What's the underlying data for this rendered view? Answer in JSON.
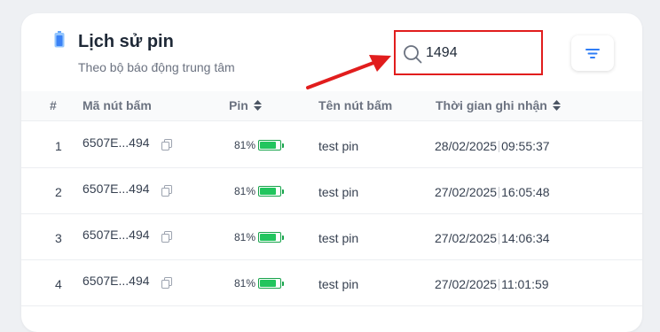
{
  "header": {
    "title": "Lịch sử pin",
    "subtitle": "Theo bộ báo động trung tâm"
  },
  "search": {
    "value": "1494"
  },
  "table": {
    "columns": {
      "index": "#",
      "button_code": "Mã nút bấm",
      "battery": "Pin",
      "button_name": "Tên nút bấm",
      "recorded_time": "Thời gian ghi nhận"
    },
    "rows": [
      {
        "index": "1",
        "code": "6507E...494",
        "battery": "81%",
        "battery_level": 0.81,
        "name": "test pin",
        "date": "28/02/2025",
        "time": "09:55:37"
      },
      {
        "index": "2",
        "code": "6507E...494",
        "battery": "81%",
        "battery_level": 0.81,
        "name": "test pin",
        "date": "27/02/2025",
        "time": "16:05:48"
      },
      {
        "index": "3",
        "code": "6507E...494",
        "battery": "81%",
        "battery_level": 0.81,
        "name": "test pin",
        "date": "27/02/2025",
        "time": "14:06:34"
      },
      {
        "index": "4",
        "code": "6507E...494",
        "battery": "81%",
        "battery_level": 0.81,
        "name": "test pin",
        "date": "27/02/2025",
        "time": "11:01:59"
      }
    ]
  },
  "colors": {
    "accent": "#2f7df6",
    "highlight_box": "#e11d1d",
    "battery_green": "#22c55e"
  }
}
